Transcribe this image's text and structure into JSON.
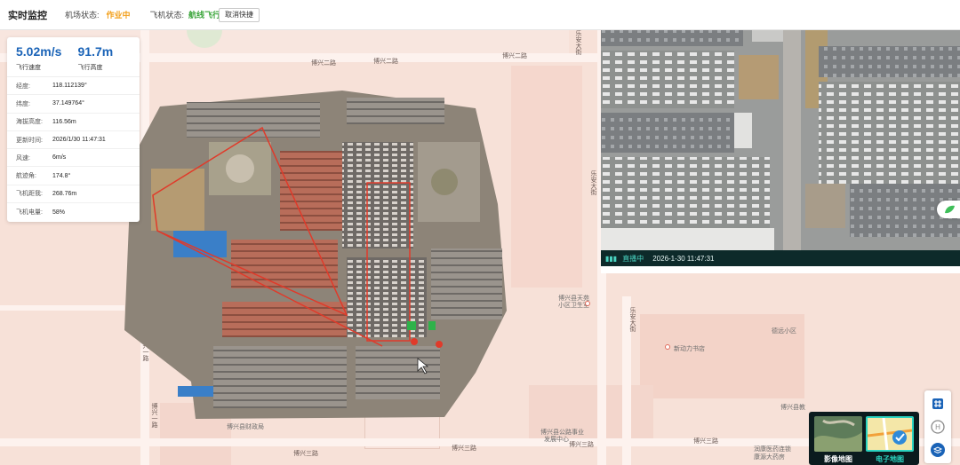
{
  "header": {
    "title": "实时监控",
    "airport_label": "机场状态:",
    "airport_value": "作业中",
    "airport_color": "#f2a01c",
    "drone_label": "飞机状态:",
    "drone_value": "航线飞行",
    "drone_color": "#3aa53a",
    "cancel_label": "取消快捷"
  },
  "telemetry": {
    "speed": {
      "value": "5.02m/s",
      "label": "飞行速度"
    },
    "altitude": {
      "value": "91.7m",
      "label": "飞行高度"
    },
    "rows": [
      {
        "k": "经度:",
        "v": "118.112139°"
      },
      {
        "k": "纬度:",
        "v": "37.149764°"
      },
      {
        "k": "海拔高度:",
        "v": "116.56m"
      },
      {
        "k": "更新时间:",
        "v": "2026/1/30 11:47:31"
      },
      {
        "k": "风速:",
        "v": "6m/s"
      },
      {
        "k": "航迹角:",
        "v": "174.8°"
      },
      {
        "k": "飞机距我:",
        "v": "268.76m"
      },
      {
        "k": "飞机电量:",
        "v": "58%"
      }
    ]
  },
  "video": {
    "live_label": "直播中",
    "timestamp": "2026-1-30 11:47:31"
  },
  "map": {
    "roads": {
      "boxing_er_1": "博兴二路",
      "boxing_er_2": "博兴二路",
      "boxing_er_3": "博兴二路",
      "boxing_san_1": "博兴三路",
      "boxing_san_2": "博兴三路",
      "boxing_san_3": "博兴三路",
      "boxing_san_4": "博兴三路",
      "boxing_yi_1": "博兴一路",
      "boxing_yi_2": "博兴一路",
      "leanda_1": "乐安大街",
      "leanda_2": "乐安大街",
      "leanda_3": "乐安大街"
    },
    "pois": {
      "tianyuan": "博兴县天苑",
      "clinic": "小区卫生室",
      "energy": "新动力书店",
      "community": "德远小区",
      "finance": "博兴县财政局",
      "jiaoyu": "博兴县教",
      "gongye_1": "博兴县公路事业",
      "gongye_2": "发展中心",
      "hospital_1": "润康医药连锁",
      "hospital_2": "康源大药房"
    }
  },
  "layers": {
    "satellite": "影像地图",
    "vector": "电子地图"
  },
  "colors": {
    "accent": "#1a63b7",
    "live_green": "#49d2c0",
    "layer_active": "#2bd3c0"
  }
}
